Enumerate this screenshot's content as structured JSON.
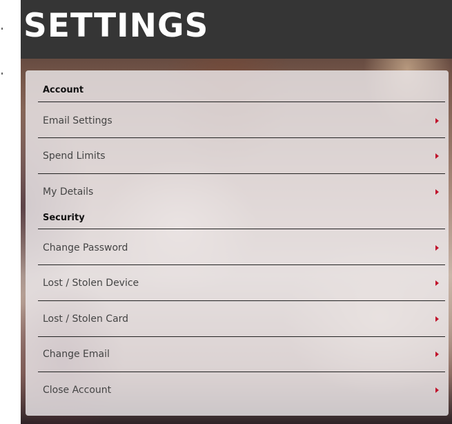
{
  "page": {
    "title": "SETTINGS"
  },
  "colors": {
    "header_bg": "#353535",
    "accent_chevron": "#c0142c",
    "title_text": "#ffffff"
  },
  "sections": [
    {
      "label": "Account",
      "items": [
        {
          "label": "Email Settings",
          "icon": "chevron-right-icon"
        },
        {
          "label": "Spend Limits",
          "icon": "chevron-right-icon"
        },
        {
          "label": "My Details",
          "icon": "chevron-right-icon"
        }
      ]
    },
    {
      "label": "Security",
      "items": [
        {
          "label": "Change Password",
          "icon": "chevron-right-icon"
        },
        {
          "label": "Lost / Stolen Device",
          "icon": "chevron-right-icon"
        },
        {
          "label": "Lost / Stolen Card",
          "icon": "chevron-right-icon"
        },
        {
          "label": "Change Email",
          "icon": "chevron-right-icon"
        },
        {
          "label": "Close Account",
          "icon": "chevron-right-icon"
        }
      ]
    }
  ]
}
